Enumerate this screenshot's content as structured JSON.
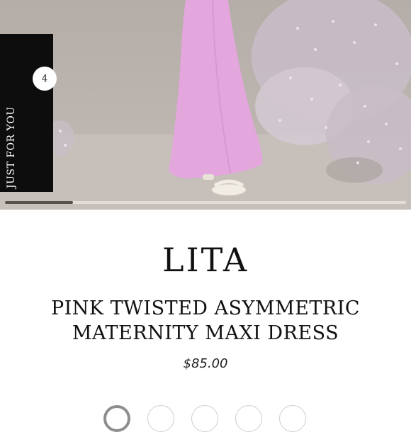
{
  "badge": {
    "count": "4",
    "label": "JUST FOR YOU"
  },
  "carousel": {
    "progress": 0.17
  },
  "product": {
    "brand": "LITA",
    "name_line1": "PINK TWISTED ASYMMETRIC",
    "name_line2": "MATERNITY MAXI DRESS",
    "price": "$85.00"
  },
  "colors": {
    "dress": "#e3a6dd",
    "backdrop": "#b9b1ab",
    "flowers": "#cfc3cf",
    "badge_bg": "#0d0d0d"
  },
  "swatches": [
    {
      "selected": true
    },
    {
      "selected": false
    },
    {
      "selected": false
    },
    {
      "selected": false
    },
    {
      "selected": false
    }
  ]
}
